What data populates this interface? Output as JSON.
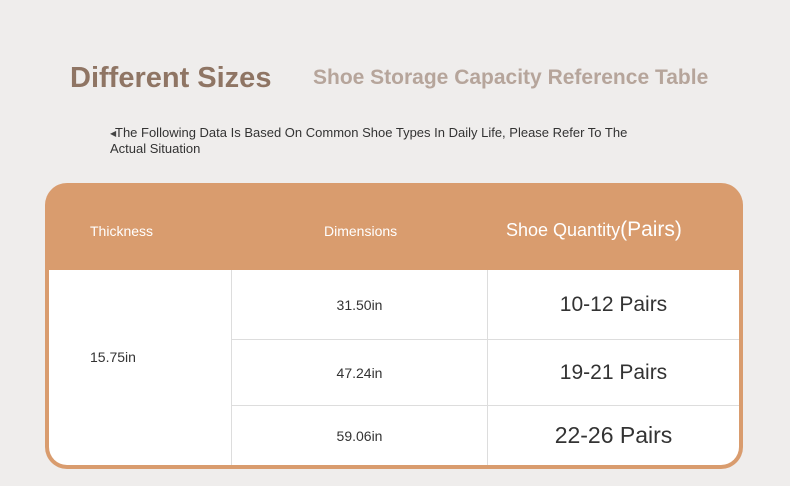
{
  "heading": {
    "main": "Different Sizes",
    "sub": "Shoe Storage Capacity Reference Table"
  },
  "note": {
    "text": "The Following Data Is Based On Common Shoe Types In Daily Life, Please Refer To The Actual Situation"
  },
  "table": {
    "headers": {
      "thickness": "Thickness",
      "dimensions": "Dimensions",
      "quantity": "Shoe Quantity",
      "quantity_unit": "(Pairs)"
    },
    "thickness_value": "15.75in",
    "rows": [
      {
        "dimension": "31.50in",
        "quantity": "10-12 Pairs"
      },
      {
        "dimension": "47.24in",
        "quantity": "19-21 Pairs"
      },
      {
        "dimension": "59.06in",
        "quantity": "22-26 Pairs"
      }
    ]
  },
  "colors": {
    "background": "#efedec",
    "header": "#d99c6e",
    "title_main": "#8f7564",
    "title_sub": "#b6a59b"
  }
}
